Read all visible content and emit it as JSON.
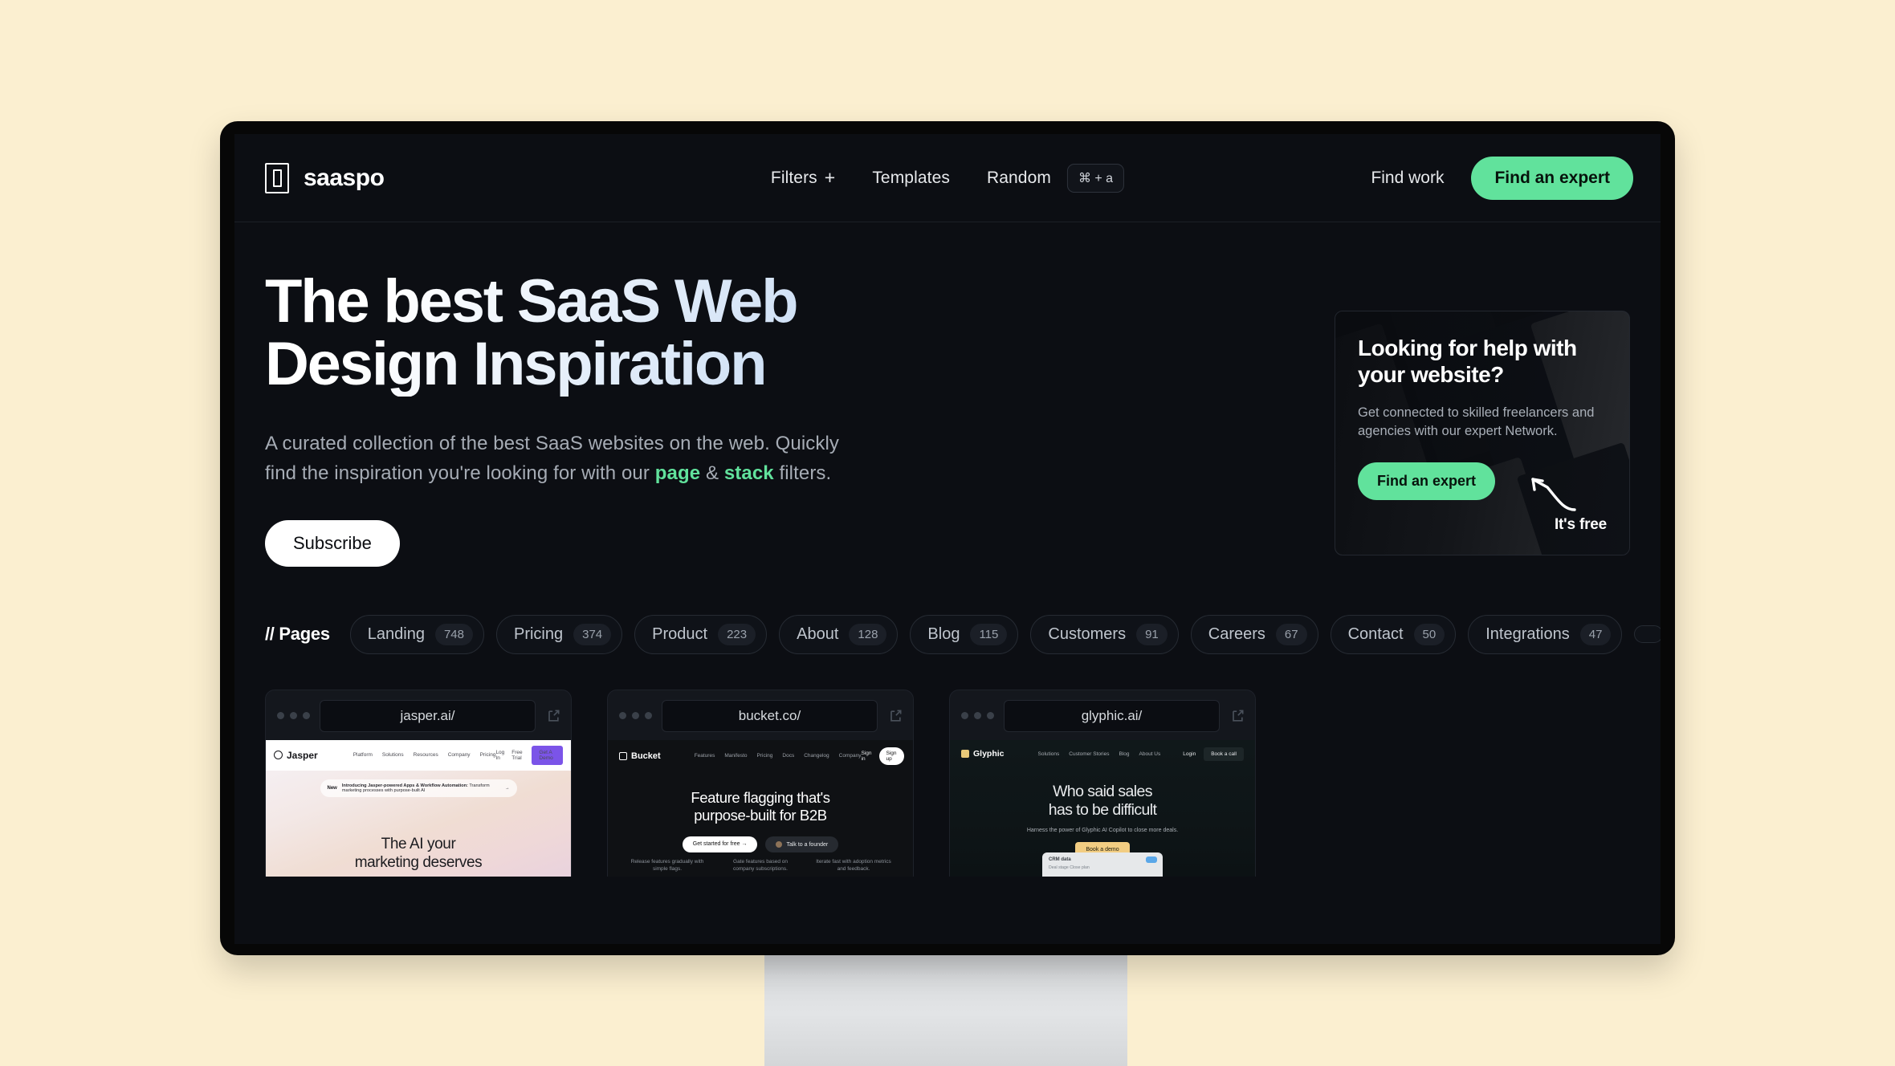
{
  "theme": {
    "page_background": "#FBEFD0",
    "screen_background": "#0c0e13",
    "accent_green": "#61E29C"
  },
  "nav": {
    "brand": "saaspo",
    "logo_icon": "saaspo-logo-icon",
    "links": [
      {
        "label": "Filters",
        "has_plus": true,
        "plus_glyph": "+"
      },
      {
        "label": "Templates",
        "has_plus": false
      },
      {
        "label": "Random",
        "has_plus": false
      }
    ],
    "shortcut_badge": "⌘ + a",
    "find_work": "Find work",
    "cta": "Find an expert"
  },
  "hero": {
    "title_line1": "The best SaaS Web",
    "title_line2": "Design Inspiration",
    "subtitle_part1": "A curated collection of the best SaaS websites on the web. Quickly find the inspiration you're looking for with our ",
    "subtitle_highlight1": "page",
    "subtitle_amp": " & ",
    "subtitle_highlight2": "stack",
    "subtitle_part2": " filters.",
    "subscribe_label": "Subscribe"
  },
  "promo": {
    "title": "Looking for help with your website?",
    "body": "Get connected to skilled freelancers and agencies with our expert Network.",
    "cta": "Find an expert",
    "annotation": "It's free",
    "arrow_icon": "curved-arrow-icon"
  },
  "filters": {
    "group_label": "// Pages",
    "pills": [
      {
        "label": "Landing",
        "count": "748"
      },
      {
        "label": "Pricing",
        "count": "374"
      },
      {
        "label": "Product",
        "count": "223"
      },
      {
        "label": "About",
        "count": "128"
      },
      {
        "label": "Blog",
        "count": "115"
      },
      {
        "label": "Customers",
        "count": "91"
      },
      {
        "label": "Careers",
        "count": "67"
      },
      {
        "label": "Contact",
        "count": "50"
      },
      {
        "label": "Integrations",
        "count": "47"
      }
    ]
  },
  "gallery": {
    "cards": [
      {
        "url": "jasper.ai/",
        "site": "jasper",
        "brand": "Jasper",
        "nav_links": [
          "Platform",
          "Solutions",
          "Resources",
          "Company",
          "Pricing"
        ],
        "nav_right": [
          "Log In",
          "Free Trial"
        ],
        "nav_cta": "Get A Demo",
        "banner_tag": "New",
        "banner_bold": "Introducing Jasper-powered Apps & Workflow Automation:",
        "banner_text": " Transform marketing processes with purpose-built AI",
        "banner_arrow": "→",
        "headline_line1": "The AI your",
        "headline_line2": "marketing deserves"
      },
      {
        "url": "bucket.co/",
        "site": "bucket",
        "brand": "Bucket",
        "nav_links": [
          "Features",
          "Manifesto",
          "Pricing",
          "Docs",
          "Changelog",
          "Company"
        ],
        "sign_in": "Sign in",
        "sign_up": "Sign up",
        "headline_line1": "Feature flagging that's",
        "headline_line2": "purpose-built for B2B",
        "btn_primary": "Get started for free  →",
        "btn_secondary": "Talk to a founder",
        "features": [
          "Release features gradually with simple flags.",
          "Gate features based on company subscriptions.",
          "Iterate fast with adoption metrics and feedback."
        ]
      },
      {
        "url": "glyphic.ai/",
        "site": "glyphic",
        "brand": "Glyphic",
        "nav_links": [
          "Solutions",
          "Customer Stories",
          "Blog",
          "About Us"
        ],
        "login": "Login",
        "book_call": "Book a call",
        "headline_line1": "Who said sales",
        "headline_line2": "has to be difficult",
        "subtext": "Harness the power of Glyphic AI Copilot to close more deals.",
        "cta": "Book a demo",
        "panel_title": "CRM data",
        "panel_row": "Deal stage        Close plan"
      }
    ]
  }
}
